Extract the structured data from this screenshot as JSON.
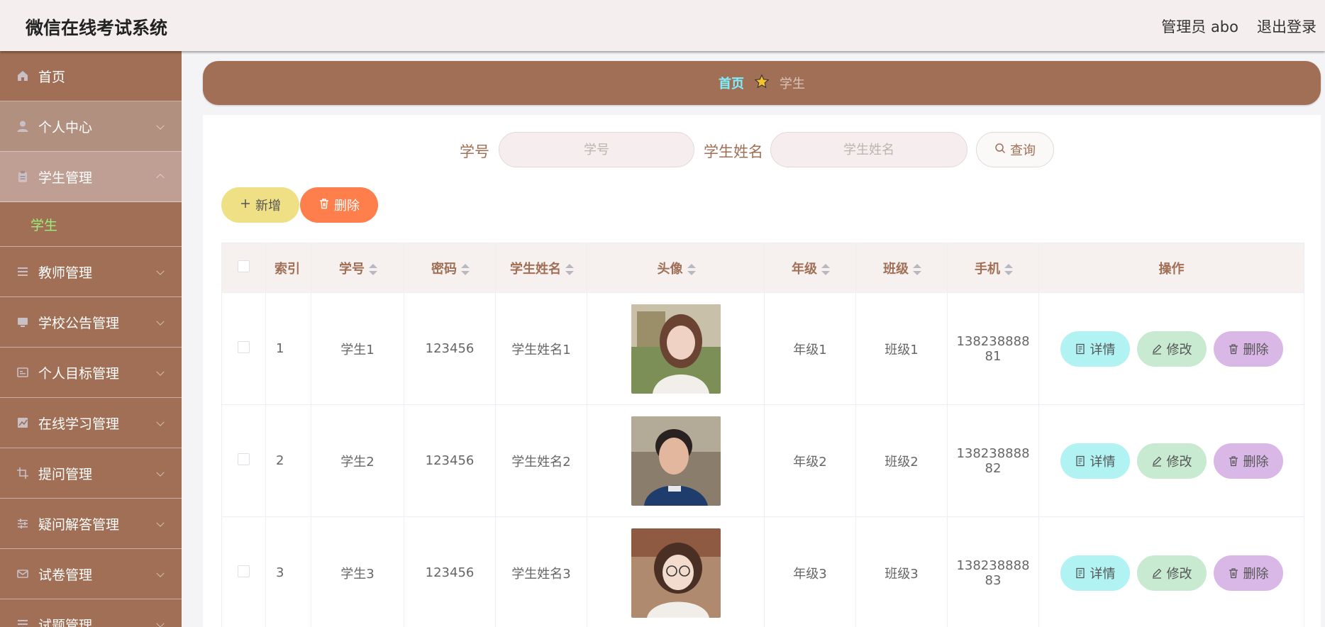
{
  "header": {
    "title": "微信在线考试系统",
    "admin": "管理员 abo",
    "logout": "退出登录"
  },
  "sidebar": {
    "items": [
      {
        "label": "首页",
        "icon": "home-icon"
      },
      {
        "label": "个人中心",
        "icon": "user-icon"
      },
      {
        "label": "学生管理",
        "icon": "clipboard-icon"
      },
      {
        "label": "教师管理",
        "icon": "list-icon"
      },
      {
        "label": "学校公告管理",
        "icon": "monitor-icon"
      },
      {
        "label": "个人目标管理",
        "icon": "card-icon"
      },
      {
        "label": "在线学习管理",
        "icon": "chart-icon"
      },
      {
        "label": "提问管理",
        "icon": "crop-icon"
      },
      {
        "label": "疑问解答管理",
        "icon": "sliders-icon"
      },
      {
        "label": "试卷管理",
        "icon": "mail-icon"
      },
      {
        "label": "试题管理",
        "icon": "list-icon"
      }
    ],
    "sub_item": "学生"
  },
  "breadcrumb": {
    "home": "首页",
    "current": "学生"
  },
  "search": {
    "label_id": "学号",
    "placeholder_id": "学号",
    "label_name": "学生姓名",
    "placeholder_name": "学生姓名",
    "query": "查询"
  },
  "actions": {
    "add": "新增",
    "delete": "删除"
  },
  "table": {
    "headers": {
      "index": "索引",
      "id": "学号",
      "password": "密码",
      "name": "学生姓名",
      "avatar": "头像",
      "grade": "年级",
      "class": "班级",
      "phone": "手机",
      "ops": "操作"
    },
    "rows": [
      {
        "index": "1",
        "id": "学生1",
        "password": "123456",
        "name": "学生姓名1",
        "grade": "年级1",
        "class": "班级1",
        "phone_a": "138238888",
        "phone_b": "81"
      },
      {
        "index": "2",
        "id": "学生2",
        "password": "123456",
        "name": "学生姓名2",
        "grade": "年级2",
        "class": "班级2",
        "phone_a": "138238888",
        "phone_b": "82"
      },
      {
        "index": "3",
        "id": "学生3",
        "password": "123456",
        "name": "学生姓名3",
        "grade": "年级3",
        "class": "班级3",
        "phone_a": "138238888",
        "phone_b": "83"
      }
    ],
    "ops": {
      "detail": "详情",
      "edit": "修改",
      "delete": "删除"
    }
  },
  "colors": {
    "brand": "#a06f55",
    "breadcrumb_home": "#7ef0ff",
    "submenu_active": "#9af07a",
    "add": "#efe085",
    "delete": "#fe7f4c",
    "detail": "#b1f2f2",
    "edit": "#c7ead0",
    "row_delete": "#d9b7e6"
  }
}
